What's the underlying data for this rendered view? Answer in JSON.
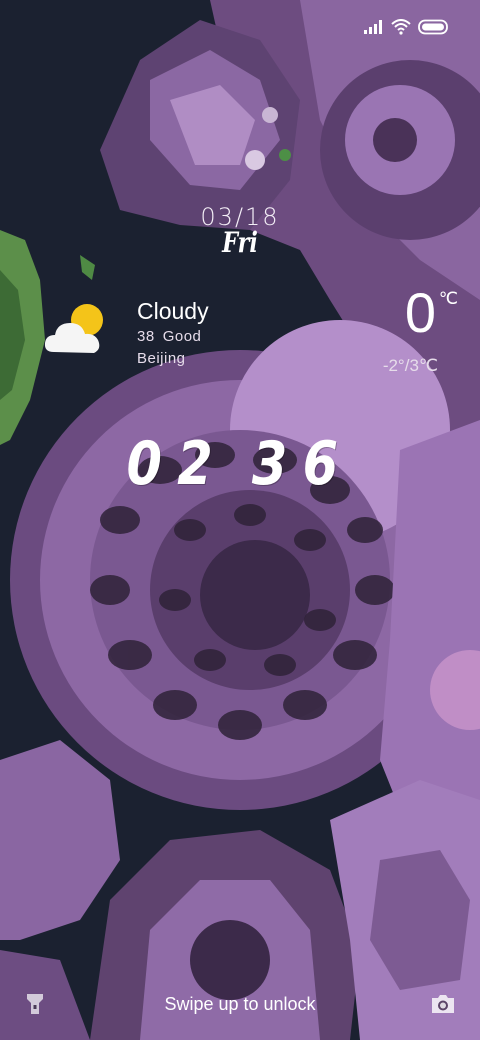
{
  "lockscreen": {
    "date": "03/18",
    "day": "Fri",
    "time_hours": "02",
    "time_minutes": "36",
    "unlock_hint": "Swipe up to unlock"
  },
  "weather": {
    "condition": "Cloudy",
    "aqi_value": "38",
    "aqi_label": "Good",
    "city": "Beijing",
    "temperature": "0",
    "unit": "℃",
    "range": "-2°/3℃",
    "icon": "partly-cloudy-icon"
  },
  "status_bar": {
    "icons": [
      "signal-icon",
      "wifi-icon",
      "battery-icon"
    ]
  },
  "shortcuts": {
    "left_icon": "flashlight-icon",
    "right_icon": "camera-icon"
  },
  "colors": {
    "wallpaper_dark": "#1a1f2e",
    "wallpaper_purple": "#7a5a8e",
    "wallpaper_light": "#b98fcf",
    "sun": "#f4c419"
  }
}
